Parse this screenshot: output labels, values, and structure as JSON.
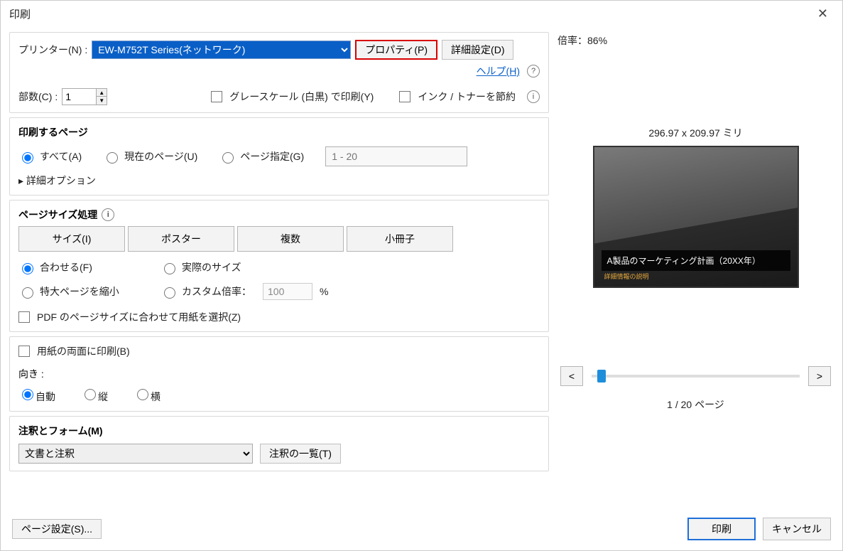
{
  "window": {
    "title": "印刷"
  },
  "printer": {
    "label": "プリンター(N) :",
    "value": "EW-M752T Series(ネットワーク)",
    "properties_btn": "プロパティ(P)",
    "advanced_btn": "詳細設定(D)"
  },
  "help": {
    "link": "ヘルプ(H)"
  },
  "copies": {
    "label": "部数(C) :",
    "value": "1"
  },
  "grayscale": {
    "label": "グレースケール (白黒) で印刷(Y)"
  },
  "inksave": {
    "label": "インク / トナーを節約"
  },
  "pages_to_print": {
    "title": "印刷するページ",
    "all": "すべて(A)",
    "current": "現在のページ(U)",
    "range": "ページ指定(G)",
    "range_placeholder": "1 - 20",
    "more": "詳細オプション"
  },
  "pagesize": {
    "title": "ページサイズ処理",
    "tabs": [
      "サイズ(I)",
      "ポスター",
      "複数",
      "小冊子"
    ],
    "fit": "合わせる(F)",
    "actual": "実際のサイズ",
    "shrink": "特大ページを縮小",
    "custom": "カスタム倍率：",
    "custom_value": "100",
    "percent": "%",
    "choose_paper": "PDF のページサイズに合わせて用紙を選択(Z)"
  },
  "duplex": {
    "both_sides": "用紙の両面に印刷(B)",
    "orient_label": "向き :",
    "auto": "自動",
    "portrait": "縦",
    "landscape": "横"
  },
  "annotations": {
    "title": "注釈とフォーム(M)",
    "value": "文書と注釈",
    "list_btn": "注釈の一覧(T)"
  },
  "preview": {
    "scale_label": "倍率：86%",
    "size": "296.97 x 209.97 ミリ",
    "slide_title": "A製品のマーケティング計画（20XX年）",
    "slide_sub": "詳細情報の説明",
    "prev": "<",
    "next": ">",
    "page_status": "1 / 20 ページ"
  },
  "footer": {
    "page_setup": "ページ設定(S)...",
    "print": "印刷",
    "cancel": "キャンセル"
  }
}
